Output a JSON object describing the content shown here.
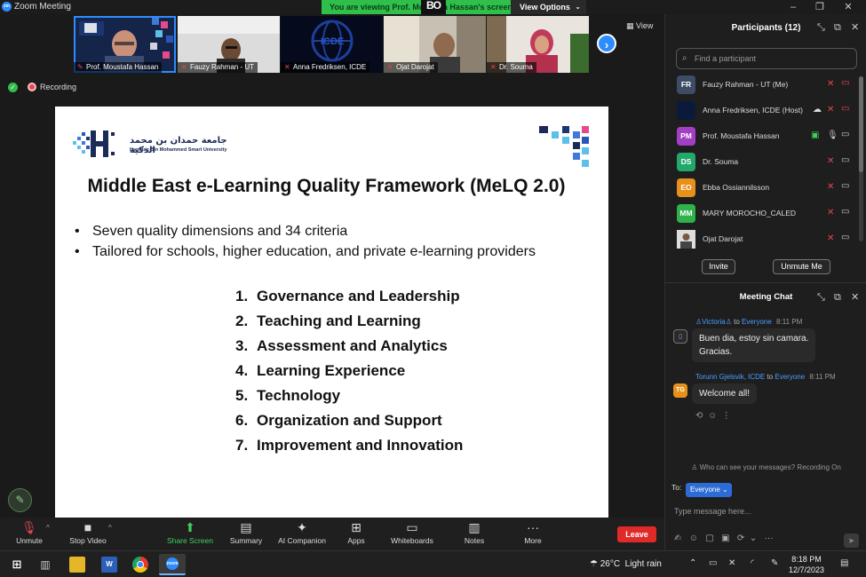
{
  "window": {
    "app_title": "Zoom Meeting",
    "viewing_banner": "You are viewing Prof. Moustafa Hassan's screen",
    "view_options": "View Options",
    "bo_logo": "BO"
  },
  "video_strip": {
    "tiles": [
      {
        "name": "Prof. Moustafa Hassan"
      },
      {
        "name": "Fauzy Rahman - UT"
      },
      {
        "name": "Anna Fredriksen, ICDE"
      },
      {
        "name": "Ojat Darojat"
      },
      {
        "name": "Dr. Souma"
      }
    ],
    "icde_logo_text": "ICDE",
    "view_label": "View",
    "recording_label": "Recording"
  },
  "slide": {
    "university_name_ar": "جامعة حمدان بن محمد الذكية",
    "university_name_en": "Hamdan Bin Mohammed Smart University",
    "title": "Middle East e-Learning Quality Framework (MeLQ 2.0)",
    "bullets": [
      "Seven quality dimensions and 34 criteria",
      "Tailored for schools, higher education, and private e-learning providers"
    ],
    "dimensions": [
      {
        "num": "1.",
        "text": "Governance and Leadership"
      },
      {
        "num": "2.",
        "text": "Teaching and Learning"
      },
      {
        "num": "3.",
        "text": "Assessment and Analytics"
      },
      {
        "num": "4.",
        "text": "Learning Experience"
      },
      {
        "num": "5.",
        "text": "Technology"
      },
      {
        "num": "6.",
        "text": "Organization and Support"
      },
      {
        "num": "7.",
        "text": "Improvement and Innovation"
      }
    ]
  },
  "toolbar": {
    "unmute": "Unmute",
    "stop_video": "Stop Video",
    "share_screen": "Share Screen",
    "summary": "Summary",
    "ai_companion": "AI Companion",
    "apps": "Apps",
    "whiteboards": "Whiteboards",
    "notes": "Notes",
    "more": "More",
    "leave": "Leave"
  },
  "participants": {
    "title": "Participants (12)",
    "search_placeholder": "Find a participant",
    "list": [
      {
        "initials": "FR",
        "name": "Fauzy Rahman - UT (Me)",
        "color": "#3d4d66"
      },
      {
        "initials": "",
        "name": "Anna Fredriksen, ICDE (Host)",
        "color": "#0b1a3a"
      },
      {
        "initials": "PM",
        "name": "Prof. Moustafa Hassan",
        "color": "#a33fc5"
      },
      {
        "initials": "DS",
        "name": "Dr. Souma",
        "color": "#23a86b"
      },
      {
        "initials": "EO",
        "name": "Ebba Ossiannilsson",
        "color": "#e8901c"
      },
      {
        "initials": "MM",
        "name": "MARY MOROCHO_CALED",
        "color": "#2fb24c"
      },
      {
        "initials": "",
        "name": "Ojat Darojat",
        "color": "#cfcfcf"
      }
    ],
    "invite": "Invite",
    "unmute_me": "Unmute Me"
  },
  "chat": {
    "title": "Meeting Chat",
    "messages": [
      {
        "sender": "Victoria",
        "to_word": "to",
        "recipient": "Everyone",
        "time": "8:11 PM",
        "text_line1": "Buen dia, estoy sin camara.",
        "text_line2": "Gracias."
      },
      {
        "sender": "Torunn Gjelsvik, ICDE",
        "to_word": "to",
        "recipient": "Everyone",
        "time": "8:11 PM",
        "text_line1": "Welcome all!",
        "initials": "TG"
      }
    ],
    "privacy_note": "Who can see your messages? Recording On",
    "to_label": "To:",
    "to_value": "Everyone",
    "input_placeholder": "Type message here..."
  },
  "taskbar": {
    "temperature": "26°C",
    "weather": "Light rain",
    "time": "8:18 PM",
    "date": "12/7/2023",
    "zoom_label": "zoom",
    "word_label": "W"
  }
}
